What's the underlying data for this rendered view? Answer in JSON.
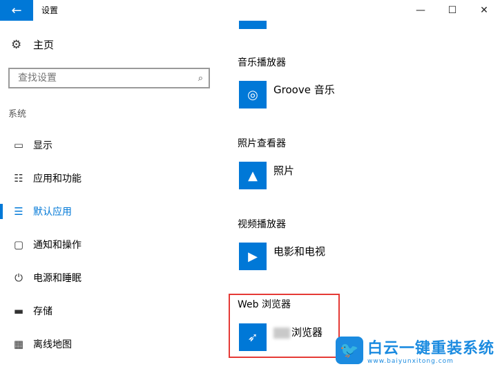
{
  "window": {
    "title": "设置",
    "back_icon": "←",
    "min_icon": "—",
    "max_icon": "☐",
    "close_icon": "✕"
  },
  "sidebar": {
    "home_icon": "⚙",
    "home_label": "主页",
    "search_placeholder": "查找设置",
    "search_icon": "⌕",
    "section_label": "系统",
    "items": [
      {
        "icon": "▭",
        "label": "显示"
      },
      {
        "icon": "☷",
        "label": "应用和功能"
      },
      {
        "icon": "☰",
        "label": "默认应用",
        "active": true
      },
      {
        "icon": "▢",
        "label": "通知和操作"
      },
      {
        "icon": "⏻",
        "label": "电源和睡眠"
      },
      {
        "icon": "▬",
        "label": "存储"
      },
      {
        "icon": "▦",
        "label": "离线地图"
      }
    ]
  },
  "content": {
    "music": {
      "category": "音乐播放器",
      "icon": "◎",
      "app": "Groove 音乐"
    },
    "photos": {
      "category": "照片查看器",
      "icon": "▲",
      "app": "照片"
    },
    "video": {
      "category": "视频播放器",
      "icon": "▶",
      "app": "电影和电视"
    },
    "web": {
      "category": "Web 浏览器",
      "icon": "➶",
      "app": "浏览器"
    }
  },
  "watermark": {
    "icon": "🐦",
    "title": "白云一键重装系统",
    "url": "www.baiyunxitong.com"
  },
  "colors": {
    "accent": "#0078d7",
    "highlight": "#e53935"
  }
}
